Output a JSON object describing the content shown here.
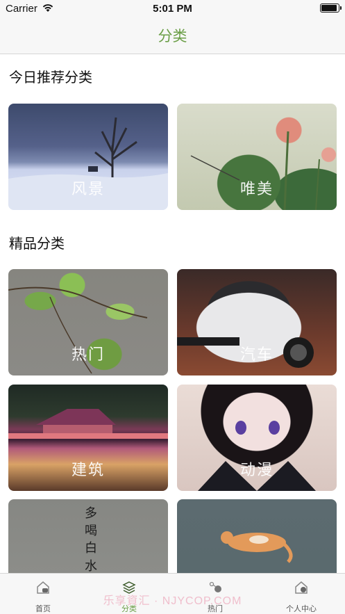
{
  "status_bar": {
    "carrier": "Carrier",
    "time": "5:01 PM"
  },
  "nav": {
    "title": "分类"
  },
  "sections": {
    "recommended_title": "今日推荐分类",
    "featured_title": "精品分类"
  },
  "recommended": [
    {
      "label": "风景",
      "icon": "landscape-image"
    },
    {
      "label": "唯美",
      "icon": "lotus-image"
    }
  ],
  "featured": [
    {
      "label": "热门",
      "icon": "leaves-image"
    },
    {
      "label": "汽车",
      "icon": "car-image"
    },
    {
      "label": "建筑",
      "icon": "building-image"
    },
    {
      "label": "动漫",
      "icon": "anime-image"
    },
    {
      "label": "",
      "icon": "calligraphy-image",
      "image_text": [
        "多",
        "喝",
        "白",
        "水"
      ]
    },
    {
      "label": "",
      "icon": "cat-image"
    }
  ],
  "tabs": [
    {
      "label": "首页",
      "icon": "home-icon",
      "active": false
    },
    {
      "label": "分类",
      "icon": "layers-icon",
      "active": true
    },
    {
      "label": "热门",
      "icon": "share-icon",
      "active": false
    },
    {
      "label": "个人中心",
      "icon": "user-center-icon",
      "active": false
    }
  ],
  "watermark": "乐享資汇 · NJYCOP.COM",
  "colors": {
    "accent": "#6a9e46",
    "bar_background": "#f7f7f7"
  }
}
